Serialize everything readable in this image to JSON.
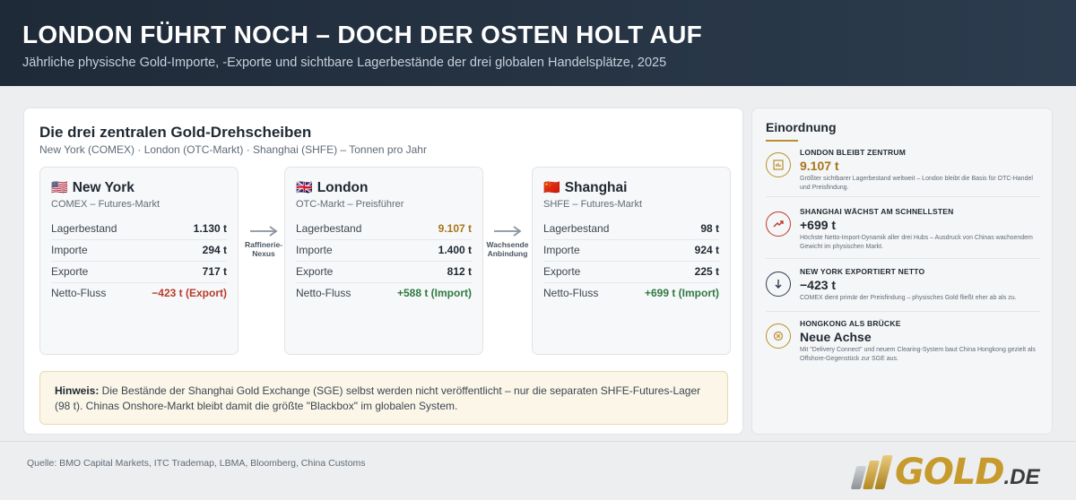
{
  "header": {
    "title": "LONDON FÜHRT NOCH – DOCH DER OSTEN HOLT AUF",
    "subtitle": "Jährliche physische Gold-Importe, -Exporte und sichtbare Lagerbestände der drei globalen Handelsplätze, 2025"
  },
  "main": {
    "title": "Die drei zentralen Gold-Drehscheiben",
    "subtitle": "New York (COMEX) · London (OTC-Markt) · Shanghai (SHFE) – Tonnen pro Jahr",
    "hubs": [
      {
        "flag": "🇺🇸",
        "name": "New York",
        "sub": "COMEX – Futures-Markt",
        "rows": [
          {
            "label": "Lagerbestand",
            "value": "1.130 t"
          },
          {
            "label": "Importe",
            "value": "294 t"
          },
          {
            "label": "Exporte",
            "value": "717 t"
          },
          {
            "label": "Netto-Fluss",
            "value": "−423 t (Export)"
          }
        ]
      },
      {
        "flag": "🇬🇧",
        "name": "London",
        "sub": "OTC-Markt – Preisführer",
        "rows": [
          {
            "label": "Lagerbestand",
            "value": "9.107 t"
          },
          {
            "label": "Importe",
            "value": "1.400 t"
          },
          {
            "label": "Exporte",
            "value": "812 t"
          },
          {
            "label": "Netto-Fluss",
            "value": "+588 t (Import)"
          }
        ]
      },
      {
        "flag": "🇨🇳",
        "name": "Shanghai",
        "sub": "SHFE – Futures-Markt",
        "rows": [
          {
            "label": "Lagerbestand",
            "value": "98 t"
          },
          {
            "label": "Importe",
            "value": "924 t"
          },
          {
            "label": "Exporte",
            "value": "225 t"
          },
          {
            "label": "Netto-Fluss",
            "value": "+699 t (Import)"
          }
        ]
      }
    ],
    "connectors": [
      {
        "line1": "Raffinerie-",
        "line2": "Nexus"
      },
      {
        "line1": "Wachsende",
        "line2": "Anbindung"
      }
    ],
    "note": {
      "label": "Hinweis:",
      "text": " Die Bestände der Shanghai Gold Exchange (SGE) selbst werden nicht veröffentlicht – nur die separaten SHFE-Futures-Lager (98 t). Chinas Onshore-Markt bleibt damit die größte \"Blackbox\" im globalen System."
    }
  },
  "side": {
    "title": "Einordnung",
    "items": [
      {
        "icon": "chart-icon",
        "label": "LONDON BLEIBT ZENTRUM",
        "value": "9.107 t",
        "desc": "Größter sichtbarer Lagerbestand weltweit – London bleibt die Basis für OTC-Handel und Preisfindung.",
        "color": "#b8912a"
      },
      {
        "icon": "trend-up-icon",
        "label": "SHANGHAI WÄCHST AM SCHNELLSTEN",
        "value": "+699 t",
        "desc": "Höchste Netto-Import-Dynamik aller drei Hubs – Ausdruck von Chinas wachsendem Gewicht im physischen Markt.",
        "color": "#c0392b"
      },
      {
        "icon": "arrow-down-icon",
        "label": "NEW YORK EXPORTIERT NETTO",
        "value": "−423 t",
        "desc": "COMEX dient primär der Preisfindung – physisches Gold fließt eher ab als zu.",
        "color": "#2c3e50"
      },
      {
        "icon": "exchange-icon",
        "label": "HONGKONG ALS BRÜCKE",
        "value": "Neue Achse",
        "desc": "Mit \"Delivery Connect\" und neuem Clearing-System baut China Hongkong gezielt als Offshore-Gegenstück zur SGE aus.",
        "color": "#b8912a"
      }
    ]
  },
  "footer": {
    "source": "Quelle: BMO Capital Markets, ITC Trademap, LBMA, Bloomberg, China Customs",
    "logo_text": "GOLD",
    "logo_tld": ".DE"
  }
}
